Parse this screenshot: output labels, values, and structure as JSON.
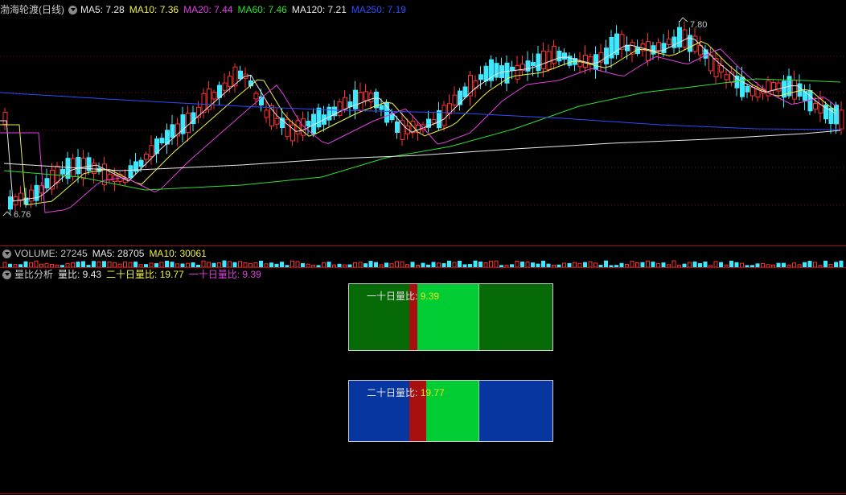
{
  "header": {
    "title": "渤海轮渡(日线)",
    "ma": [
      {
        "label": "MA5: 7.28",
        "color": "#e8e8e8"
      },
      {
        "label": "MA10: 7.36",
        "color": "#f0f04a"
      },
      {
        "label": "MA20: 7.44",
        "color": "#e040e0"
      },
      {
        "label": "MA60: 7.46",
        "color": "#30e030"
      },
      {
        "label": "MA120: 7.21",
        "color": "#e8e8e8"
      },
      {
        "label": "MA250: 7.19",
        "color": "#2a4dff"
      }
    ]
  },
  "price_chart": {
    "high_label": "7.80",
    "low_label": "6.76",
    "series": [
      {
        "name": "MA5",
        "color": "#e8e8e8"
      },
      {
        "name": "MA10",
        "color": "#f0f04a"
      },
      {
        "name": "MA20",
        "color": "#e040e0"
      },
      {
        "name": "MA60",
        "color": "#30e030"
      },
      {
        "name": "MA120",
        "color": "#e8e8e8"
      },
      {
        "name": "MA250",
        "color": "#2a4dff"
      }
    ]
  },
  "volume_bar": {
    "title": "VOLUME: 27245",
    "ma5": "MA5: 28705",
    "ma10": "MA10: 30061"
  },
  "ratio_bar": {
    "title": "量比分析",
    "qb": "量比: 9.43",
    "twenty": "二十日量比: 19.77",
    "ten": "一十日量比: 9.39"
  },
  "panel_ten": {
    "label": "一十日量比:",
    "value": "9.39",
    "bg": "#066a06",
    "accent": "#00cc33"
  },
  "panel_twenty": {
    "label": "二十日量比:",
    "value": "19.77",
    "bg": "#0836a0",
    "accent": "#00cc33"
  },
  "colors": {
    "up": "#ff3030",
    "down": "#40e8ff",
    "grid": "#7a1010"
  }
}
